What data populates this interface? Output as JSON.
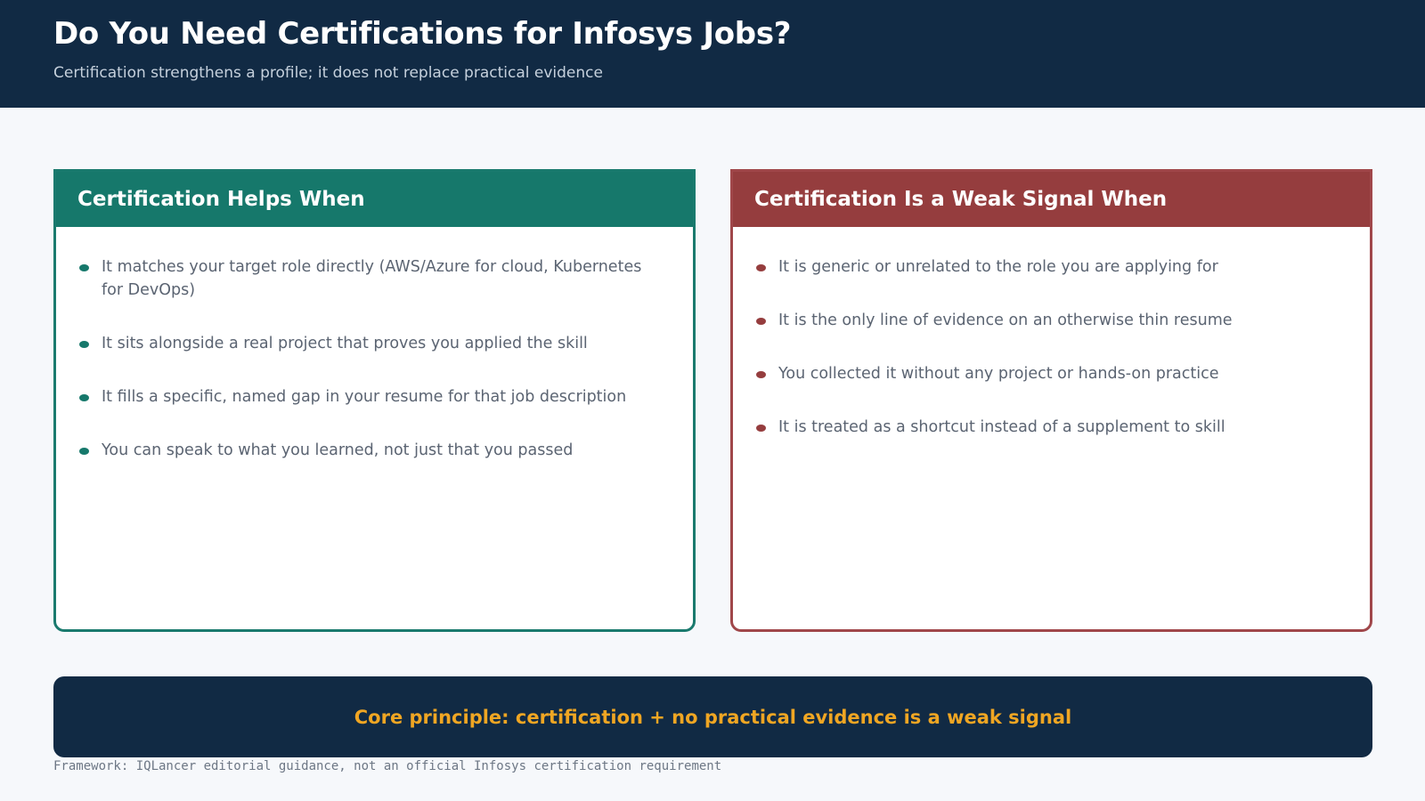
{
  "header": {
    "title": "Do You Need Certifications for Infosys Jobs?",
    "subtitle": "Certification strengthens a profile; it does not replace practical evidence"
  },
  "cards": [
    {
      "heading": "Certification Helps When",
      "color": "#16786b",
      "items": [
        "It matches your target role directly (AWS/Azure for cloud, Kubernetes for DevOps)",
        "It sits alongside a real project that proves you applied the skill",
        "It fills a specific, named gap in your resume for that job description",
        "You can speak to what you learned, not just that you passed"
      ]
    },
    {
      "heading": "Certification Is a Weak Signal When",
      "color": "#953d3e",
      "items": [
        "It is generic or unrelated to the role you are applying for",
        "It is the only line of evidence on an otherwise thin resume",
        "You collected it without any project or hands-on practice",
        "It is treated as a shortcut instead of a supplement to skill"
      ]
    }
  ],
  "banner": {
    "text": "Core principle: certification + no practical evidence is a weak signal",
    "color": "#f0a623"
  },
  "footnote": "Framework: IQLancer editorial guidance, not an official Infosys certification requirement"
}
